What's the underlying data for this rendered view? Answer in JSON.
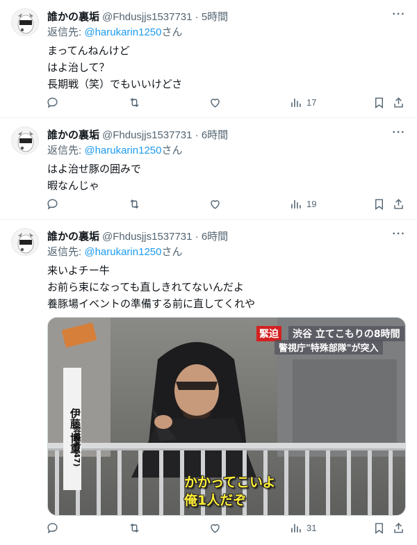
{
  "tweets": [
    {
      "display_name": "誰かの裏垢",
      "meta": "@Fhdusjjs1537731 · 5時間",
      "reply_prefix": "返信先: ",
      "reply_handle": "@harukarin1250",
      "reply_suffix": "さん",
      "lines": [
        "まってんねんけど",
        "はよ治して？",
        "長期戦（笑）でもいいけどさ"
      ],
      "views": "17"
    },
    {
      "display_name": "誰かの裏垢",
      "meta": "@Fhdusjjs1537731 · 6時間",
      "reply_prefix": "返信先: ",
      "reply_handle": "@harukarin1250",
      "reply_suffix": "さん",
      "lines": [
        "はよ治せ豚の囲みで",
        "暇なんじゃ"
      ],
      "views": "19"
    },
    {
      "display_name": "誰かの裏垢",
      "meta": "@Fhdusjjs1537731 · 6時間",
      "reply_prefix": "返信先: ",
      "reply_handle": "@harukarin1250",
      "reply_suffix": "さん",
      "lines": [
        "来いよチー牛",
        "お前ら束になっても直しきれてないんだよ",
        "養豚場イベントの準備する前に直してくれや"
      ],
      "views": "31",
      "media": {
        "tag": "緊迫",
        "headline": "渋谷 立てこもりの8時間",
        "subheadline": "警視庁\"特殊部隊\"が突入",
        "name_vertical": "伊藤 博重",
        "name_sub": "容疑者(47)",
        "caption_1": "かかってこいよ",
        "caption_2": "俺1人だぞ"
      }
    }
  ],
  "icons": {
    "more": "more-icon",
    "reply": "reply-icon",
    "retweet": "retweet-icon",
    "like": "heart-icon",
    "views": "views-icon",
    "bookmark": "bookmark-icon",
    "share": "share-icon"
  },
  "colors": {
    "link": "#1d9bf0",
    "secondary_text": "#536471",
    "divider": "#eff3f4",
    "caption_yellow": "#ffef36",
    "tag_red": "#d32020"
  }
}
